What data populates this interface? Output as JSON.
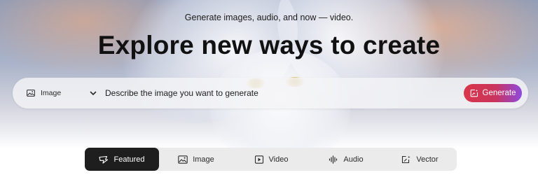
{
  "hero": {
    "subtitle": "Generate images, audio, and now — video.",
    "title": "Explore new ways to create"
  },
  "prompt": {
    "type_select": {
      "icon": "image-icon",
      "value": "Image"
    },
    "input_placeholder": "Describe the image you want to generate",
    "generate_label": "Generate",
    "generate_icon": "generate-sparkle-icon",
    "generate_gradient": [
      "#d9374a",
      "#8f4ae0"
    ]
  },
  "tabs": [
    {
      "label": "Featured",
      "icon": "featured-icon",
      "active": true
    },
    {
      "label": "Image",
      "icon": "image-icon",
      "active": false
    },
    {
      "label": "Video",
      "icon": "video-icon",
      "active": false
    },
    {
      "label": "Audio",
      "icon": "audio-waveform-icon",
      "active": false
    },
    {
      "label": "Vector",
      "icon": "vector-icon",
      "active": false
    }
  ],
  "colors": {
    "tab_active_bg": "#1e1e1e",
    "tab_bar_bg": "#ebebeb"
  }
}
